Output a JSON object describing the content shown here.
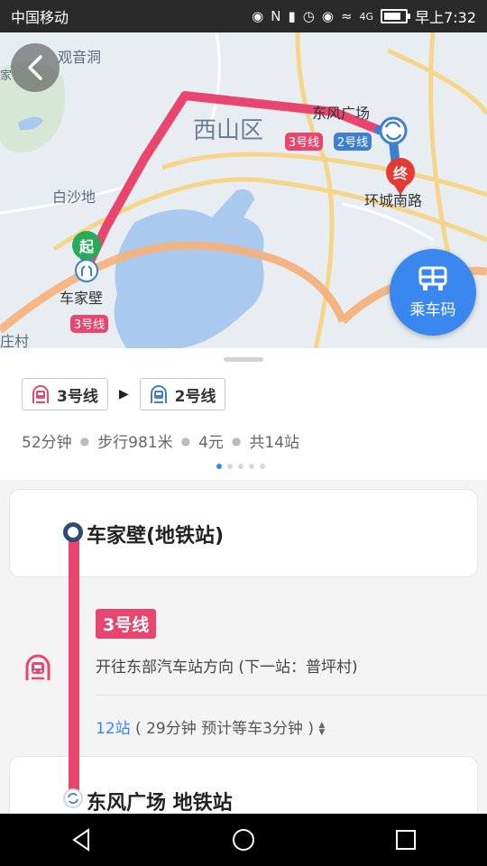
{
  "status_bar": {
    "carrier": "中国移动",
    "signal_label": "4G",
    "time": "早上7:32"
  },
  "map": {
    "district_label": "西山区",
    "place_labels": [
      "观音洞",
      "白沙地",
      "庄村",
      "家"
    ],
    "start_marker": "起",
    "end_marker": "终",
    "start_station": "车家壁",
    "transfer_station": "东风广场",
    "end_station": "环城南路",
    "route_line_labels": [
      "3号线",
      "3号线",
      "2号线"
    ],
    "ride_code_button": "乘车码",
    "colors": {
      "line3": "#e8466e",
      "line2": "#3f7fd0",
      "water": "#a9c9ee"
    }
  },
  "summary": {
    "lines": [
      {
        "label": "3号线",
        "color": "#e8466e"
      },
      {
        "label": "2号线",
        "color": "#3f7fd0"
      }
    ],
    "duration": "52分钟",
    "walk": "步行981米",
    "fare": "4元",
    "stops_total": "共14站",
    "page_count": 5,
    "page_active": 0
  },
  "detail": {
    "start_station": "车家壁(地铁站)",
    "line_label": "3号线",
    "direction": "开往东部汽车站方向 (下一站：普坪村)",
    "stop_count": "12站",
    "ride_info": "( 29分钟 预计等车3分钟 )",
    "expand_icon": "sort-icon",
    "transfer_station": "东风广场 地铁站"
  },
  "nav_bar": {
    "icons": [
      "back-triangle-icon",
      "home-circle-icon",
      "recents-square-icon"
    ]
  }
}
